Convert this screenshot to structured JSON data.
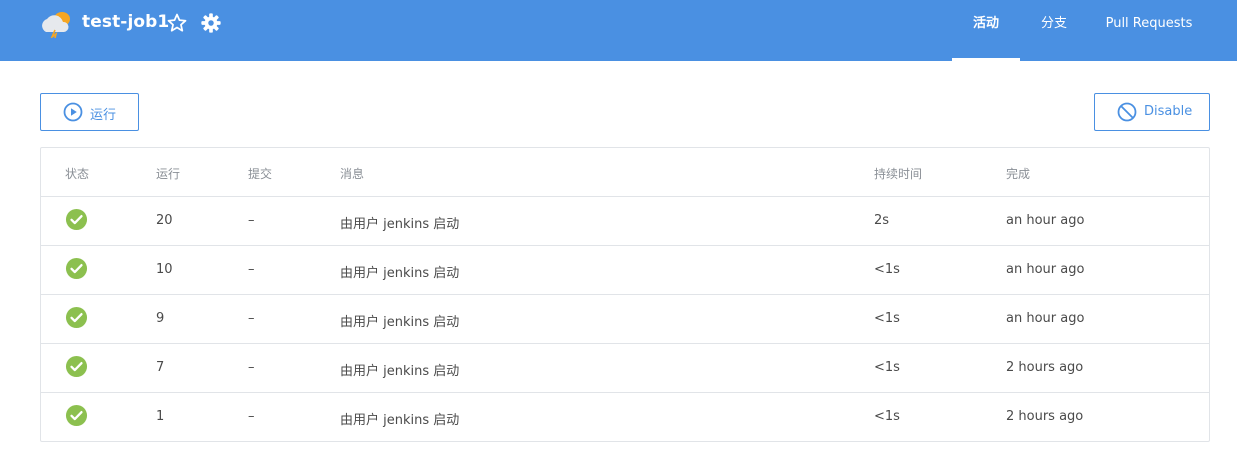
{
  "header": {
    "job_name": "test-job1",
    "weather_icon": "cloud-lightning-icon",
    "star_icon": "star-outline-icon",
    "gear_icon": "gear-icon",
    "tabs": [
      {
        "label": "活动",
        "active": true
      },
      {
        "label": "分支",
        "active": false
      },
      {
        "label": "Pull Requests",
        "active": false
      }
    ],
    "background_color": "#4a90e2"
  },
  "toolbar": {
    "run_label": "运行",
    "run_icon": "play-circle-icon",
    "disable_label": "Disable",
    "disable_icon": "prohibited-icon",
    "accent_color": "#4a90e2"
  },
  "table": {
    "columns": [
      "状态",
      "运行",
      "提交",
      "消息",
      "持续时间",
      "完成"
    ],
    "rows": [
      {
        "status": "success",
        "run": "20",
        "commit": "–",
        "message": "由用户 jenkins 启动",
        "duration": "2s",
        "completed": "an hour ago"
      },
      {
        "status": "success",
        "run": "10",
        "commit": "–",
        "message": "由用户 jenkins 启动",
        "duration": "<1s",
        "completed": "an hour ago"
      },
      {
        "status": "success",
        "run": "9",
        "commit": "–",
        "message": "由用户 jenkins 启动",
        "duration": "<1s",
        "completed": "an hour ago"
      },
      {
        "status": "success",
        "run": "7",
        "commit": "–",
        "message": "由用户 jenkins 启动",
        "duration": "<1s",
        "completed": "2 hours ago"
      },
      {
        "status": "success",
        "run": "1",
        "commit": "–",
        "message": "由用户 jenkins 启动",
        "duration": "<1s",
        "completed": "2 hours ago"
      }
    ],
    "success_color": "#8cc04f"
  }
}
